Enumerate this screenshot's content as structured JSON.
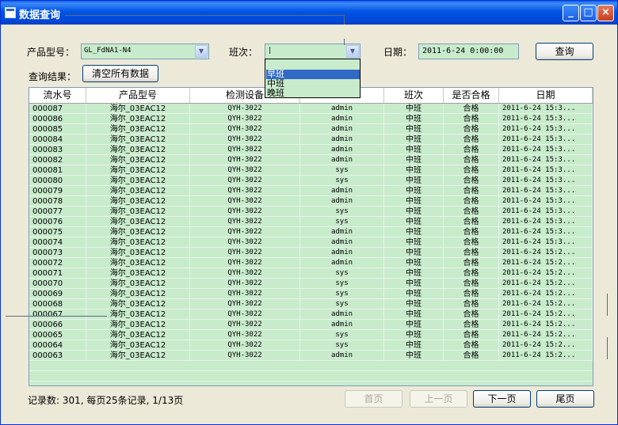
{
  "window": {
    "title": "数据查询"
  },
  "form": {
    "product_label": "产品型号：",
    "product_value": "GL_FdNA1-N4",
    "shift_label": "班次：",
    "shift_value": "|",
    "date_label": "日期：",
    "date_value": "2011-6-24 0:00:00",
    "query_button": "查询",
    "result_label": "查询结果：",
    "clear_button": "清空所有数据"
  },
  "shift_dropdown": {
    "options": [
      "早班",
      "中班",
      "晚班"
    ],
    "selected": "早班"
  },
  "table": {
    "headers": [
      "流水号",
      "产品型号",
      "检测设备",
      "",
      "班次",
      "是否合格",
      "日期"
    ],
    "rows": [
      [
        "000087",
        "海尔_03EAC12",
        "QYH-3022",
        "admin",
        "中班",
        "合格",
        "2011-6-24 15:3..."
      ],
      [
        "000086",
        "海尔_03EAC12",
        "QYH-3022",
        "admin",
        "中班",
        "合格",
        "2011-6-24 15:3..."
      ],
      [
        "000085",
        "海尔_03EAC12",
        "QYH-3022",
        "admin",
        "中班",
        "合格",
        "2011-6-24 15:3..."
      ],
      [
        "000084",
        "海尔_03EAC12",
        "QYH-3022",
        "admin",
        "中班",
        "合格",
        "2011-6-24 15:3..."
      ],
      [
        "000083",
        "海尔_03EAC12",
        "QYH-3022",
        "admin",
        "中班",
        "合格",
        "2011-6-24 15:3..."
      ],
      [
        "000082",
        "海尔_03EAC12",
        "QYH-3022",
        "admin",
        "中班",
        "合格",
        "2011-6-24 15:3..."
      ],
      [
        "000081",
        "海尔_03EAC12",
        "QYH-3022",
        "sys",
        "中班",
        "合格",
        "2011-6-24 15:3..."
      ],
      [
        "000080",
        "海尔_03EAC12",
        "QYH-3022",
        "sys",
        "中班",
        "合格",
        "2011-6-24 15:3..."
      ],
      [
        "000079",
        "海尔_03EAC12",
        "QYH-3022",
        "admin",
        "中班",
        "合格",
        "2011-6-24 15:3..."
      ],
      [
        "000078",
        "海尔_03EAC12",
        "QYH-3022",
        "admin",
        "中班",
        "合格",
        "2011-6-24 15:3..."
      ],
      [
        "000077",
        "海尔_03EAC12",
        "QYH-3022",
        "sys",
        "中班",
        "合格",
        "2011-6-24 15:3..."
      ],
      [
        "000076",
        "海尔_03EAC12",
        "QYH-3022",
        "sys",
        "中班",
        "合格",
        "2011-6-24 15:3..."
      ],
      [
        "000075",
        "海尔_03EAC12",
        "QYH-3022",
        "admin",
        "中班",
        "合格",
        "2011-6-24 15:3..."
      ],
      [
        "000074",
        "海尔_03EAC12",
        "QYH-3022",
        "admin",
        "中班",
        "合格",
        "2011-6-24 15:3..."
      ],
      [
        "000073",
        "海尔_03EAC12",
        "QYH-3022",
        "admin",
        "中班",
        "合格",
        "2011-6-24 15:2..."
      ],
      [
        "000072",
        "海尔_03EAC12",
        "QYH-3022",
        "admin",
        "中班",
        "合格",
        "2011-6-24 15:2..."
      ],
      [
        "000071",
        "海尔_03EAC12",
        "QYH-3022",
        "sys",
        "中班",
        "合格",
        "2011-6-24 15:2..."
      ],
      [
        "000070",
        "海尔_03EAC12",
        "QYH-3022",
        "sys",
        "中班",
        "合格",
        "2011-6-24 15:2..."
      ],
      [
        "000069",
        "海尔_03EAC12",
        "QYH-3022",
        "sys",
        "中班",
        "合格",
        "2011-6-24 15:2..."
      ],
      [
        "000068",
        "海尔_03EAC12",
        "QYH-3022",
        "sys",
        "中班",
        "合格",
        "2011-6-24 15:2..."
      ],
      [
        "000067",
        "海尔_03EAC12",
        "QYH-3022",
        "admin",
        "中班",
        "合格",
        "2011-6-24 15:2..."
      ],
      [
        "000066",
        "海尔_03EAC12",
        "QYH-3022",
        "admin",
        "中班",
        "合格",
        "2011-6-24 15:2..."
      ],
      [
        "000065",
        "海尔_03EAC12",
        "QYH-3022",
        "sys",
        "中班",
        "合格",
        "2011-6-24 15:2..."
      ],
      [
        "000064",
        "海尔_03EAC12",
        "QYH-3022",
        "sys",
        "中班",
        "合格",
        "2011-6-24 15:2..."
      ],
      [
        "000063",
        "海尔_03EAC12",
        "QYH-3022",
        "admin",
        "中班",
        "合格",
        "2011-6-24 15:2..."
      ]
    ]
  },
  "footer": {
    "record_info": "记录数: 301, 每页25条记录, 1/13页",
    "first_page": "首页",
    "prev_page": "上一页",
    "next_page": "下一页",
    "last_page": "尾页"
  },
  "colors": {
    "titlebar": "#0054e3",
    "field_bg": "#c8ebcc",
    "selection": "#316ac5"
  }
}
